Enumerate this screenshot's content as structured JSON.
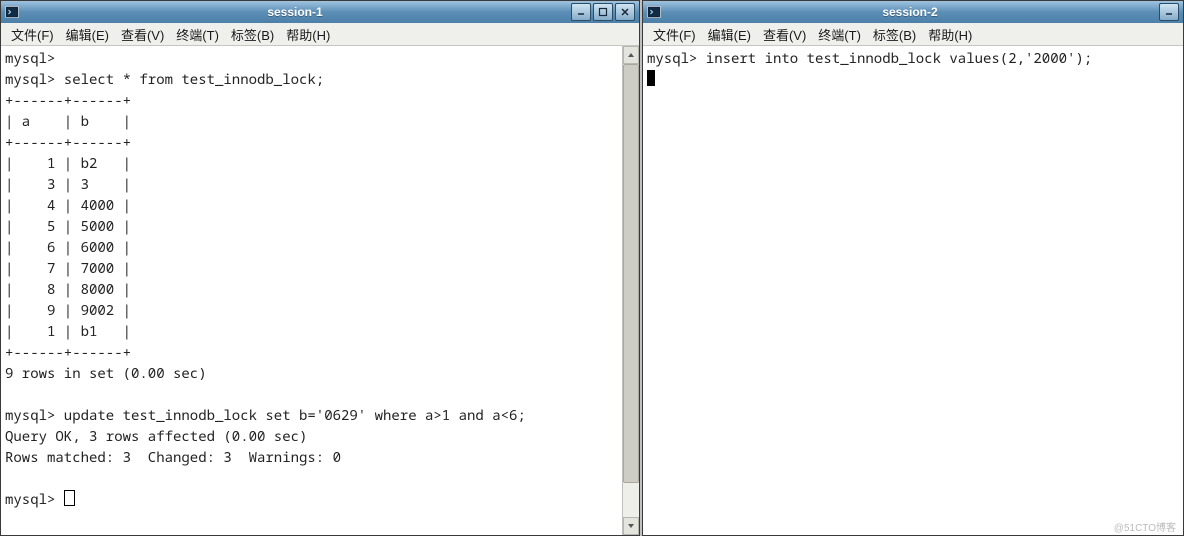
{
  "left_window": {
    "title": "session-1",
    "menu": [
      "文件(F)",
      "编辑(E)",
      "查看(V)",
      "终端(T)",
      "标签(B)",
      "帮助(H)"
    ],
    "terminal_text": "mysql>\nmysql> select * from test_innodb_lock;\n+------+------+\n| a    | b    |\n+------+------+\n|    1 | b2   |\n|    3 | 3    |\n|    4 | 4000 |\n|    5 | 5000 |\n|    6 | 6000 |\n|    7 | 7000 |\n|    8 | 8000 |\n|    9 | 9002 |\n|    1 | b1   |\n+------+------+\n9 rows in set (0.00 sec)\n\nmysql> update test_innodb_lock set b='0629' where a>1 and a<6;\nQuery OK, 3 rows affected (0.00 sec)\nRows matched: 3  Changed: 3  Warnings: 0\n\nmysql> "
  },
  "right_window": {
    "title": "session-2",
    "menu": [
      "文件(F)",
      "编辑(E)",
      "查看(V)",
      "终端(T)",
      "标签(B)",
      "帮助(H)"
    ],
    "terminal_text": "mysql> insert into test_innodb_lock values(2,'2000');\n"
  },
  "watermark": "@51CTO博客"
}
